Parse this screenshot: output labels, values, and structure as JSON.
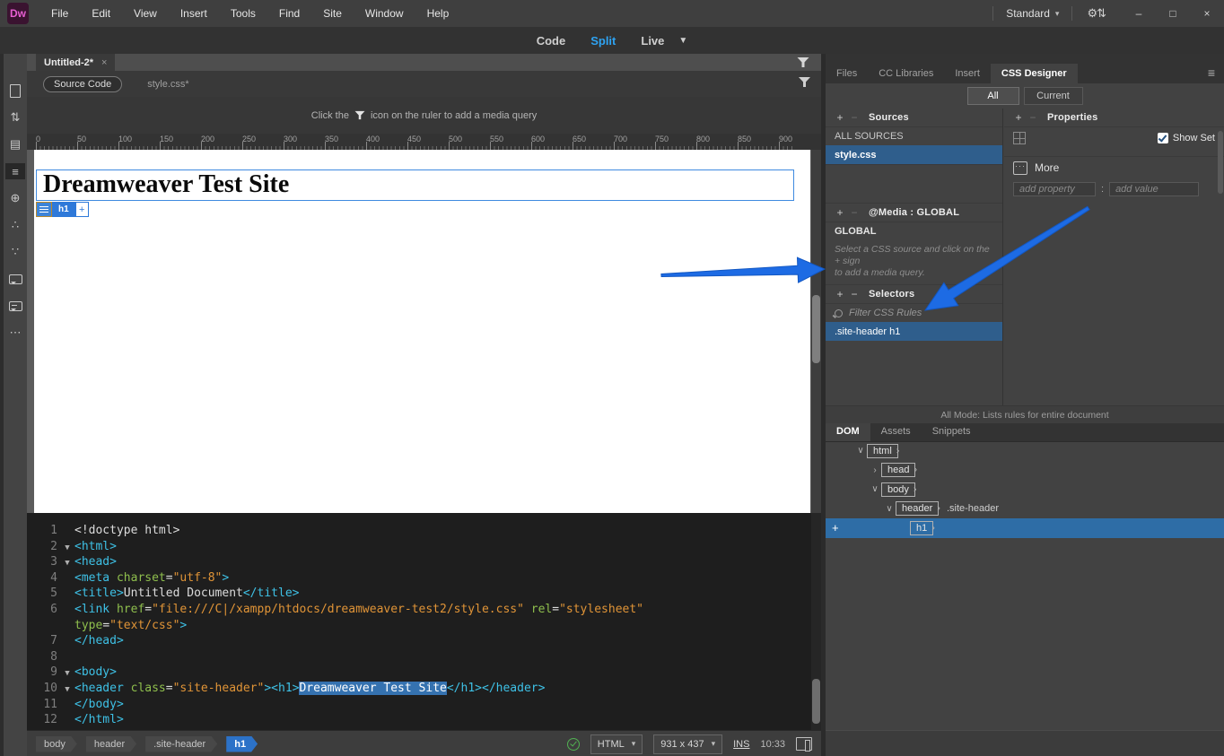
{
  "menubar": {
    "logo": "Dw",
    "items": [
      "File",
      "Edit",
      "View",
      "Insert",
      "Tools",
      "Find",
      "Site",
      "Window",
      "Help"
    ],
    "workspace": "Standard",
    "window_minimize": "–",
    "window_maximize": "□",
    "window_close": "×"
  },
  "viewbar": {
    "modes": [
      {
        "label": "Code",
        "active": false
      },
      {
        "label": "Split",
        "active": true
      },
      {
        "label": "Live",
        "active": false
      }
    ]
  },
  "left_toolbar": {
    "icons": [
      {
        "name": "new-file-icon",
        "glyph": "",
        "cls": "gi-file",
        "active": false
      },
      {
        "name": "file-transfer-icon",
        "glyph": "⇅",
        "cls": "",
        "active": false
      },
      {
        "name": "live-source-icon",
        "glyph": "▤",
        "cls": "",
        "active": false
      },
      {
        "name": "format-source-icon",
        "glyph": "≡",
        "cls": "",
        "active": true
      },
      {
        "name": "inspect-icon",
        "glyph": "⊕",
        "cls": "",
        "active": false
      },
      {
        "name": "extract-icon",
        "glyph": "∴",
        "cls": "",
        "active": false
      },
      {
        "name": "snippets-icon",
        "glyph": "∵",
        "cls": "",
        "active": false
      },
      {
        "name": "comment-icon",
        "glyph": "",
        "cls": "gi-bubble",
        "active": false
      },
      {
        "name": "comment-off-icon",
        "glyph": "",
        "cls": "gi-bubble2",
        "active": false
      },
      {
        "name": "more-options-icon",
        "glyph": "⋯",
        "cls": "",
        "active": false
      }
    ]
  },
  "doc": {
    "tab": "Untitled-2*",
    "tab_close": "×",
    "source_code": "Source Code",
    "related_file": "style.css*",
    "hint_before": "Click the",
    "hint_after": "icon on the ruler to add a media query",
    "ruler_labels": [
      "0",
      "50",
      "100",
      "150",
      "200",
      "250",
      "300",
      "350",
      "400",
      "450",
      "500",
      "550",
      "600",
      "650",
      "700",
      "750",
      "800",
      "850",
      "900"
    ],
    "design_heading": "Dreamweaver Test Site",
    "element_badge": "h1",
    "add_badge": "+"
  },
  "code": {
    "lines": [
      {
        "n": "1",
        "f": "",
        "seg": [
          [
            "p",
            "<!doctype html>"
          ]
        ]
      },
      {
        "n": "2",
        "f": "v",
        "seg": [
          [
            "t",
            "<html>"
          ]
        ]
      },
      {
        "n": "3",
        "f": "v",
        "seg": [
          [
            "t",
            "<head>"
          ]
        ]
      },
      {
        "n": "4",
        "f": "",
        "seg": [
          [
            "t",
            "<meta"
          ],
          [
            "a",
            " charset"
          ],
          [
            "p",
            "="
          ],
          [
            "v",
            "\"utf-8\""
          ],
          [
            "t",
            ">"
          ]
        ]
      },
      {
        "n": "5",
        "f": "",
        "seg": [
          [
            "t",
            "<title>"
          ],
          [
            "p",
            "Untitled Document"
          ],
          [
            "t",
            "</title>"
          ]
        ]
      },
      {
        "n": "6",
        "f": "",
        "seg": [
          [
            "t",
            "<link"
          ],
          [
            "a",
            " href"
          ],
          [
            "p",
            "="
          ],
          [
            "v",
            "\"file:///C|/xampp/htdocs/dreamweaver-test2/style.css\""
          ],
          [
            "a",
            " rel"
          ],
          [
            "p",
            "="
          ],
          [
            "v",
            "\"stylesheet\""
          ]
        ]
      },
      {
        "n": "",
        "f": "",
        "seg": [
          [
            "a",
            "type"
          ],
          [
            "p",
            "="
          ],
          [
            "v",
            "\"text/css\""
          ],
          [
            "t",
            ">"
          ]
        ]
      },
      {
        "n": "7",
        "f": "",
        "seg": [
          [
            "t",
            "</head>"
          ]
        ]
      },
      {
        "n": "8",
        "f": "",
        "seg": []
      },
      {
        "n": "9",
        "f": "v",
        "seg": [
          [
            "t",
            "<body>"
          ]
        ]
      },
      {
        "n": "10",
        "f": "v",
        "seg": [
          [
            "t",
            "<header"
          ],
          [
            "a",
            " class"
          ],
          [
            "p",
            "="
          ],
          [
            "v",
            "\"site-header\""
          ],
          [
            "t",
            "><h1>"
          ],
          [
            "s",
            "Dreamweaver Test Site"
          ],
          [
            "t",
            "</h1></header>"
          ]
        ]
      },
      {
        "n": "11",
        "f": "",
        "seg": [
          [
            "t",
            "</body>"
          ]
        ]
      },
      {
        "n": "12",
        "f": "",
        "seg": [
          [
            "t",
            "</html>"
          ]
        ]
      }
    ]
  },
  "statusbar": {
    "path": [
      "body",
      "header",
      ".site-header",
      "h1"
    ],
    "doctype": "HTML",
    "dimensions": "931 x 437",
    "mode": "INS",
    "time": "10:33"
  },
  "panel": {
    "tabs": [
      "Files",
      "CC Libraries",
      "Insert",
      "CSS Designer"
    ],
    "active_tab": "CSS Designer",
    "modes": [
      {
        "label": "All",
        "active": true
      },
      {
        "label": "Current",
        "active": false
      }
    ],
    "sources": {
      "title": "Sources",
      "item_all": "ALL SOURCES",
      "item_file": "style.css"
    },
    "media": {
      "title": "@Media :  GLOBAL",
      "item": "GLOBAL",
      "hint_line1": "Select a CSS source and click on the + sign",
      "hint_line2": "to add a media query."
    },
    "selectors": {
      "title": "Selectors",
      "filter_placeholder": "Filter CSS Rules",
      "selected": ".site-header h1"
    },
    "properties": {
      "title": "Properties",
      "show_set": "Show Set",
      "more": "More",
      "add_property": "add property",
      "add_value": "add value"
    },
    "footer": "All Mode: Lists rules for entire document"
  },
  "dom": {
    "tabs": [
      "DOM",
      "Assets",
      "Snippets"
    ],
    "active_tab": "DOM",
    "tree": [
      {
        "exp": "v",
        "tag": "html",
        "suffix": "",
        "lvl": 0,
        "sel": false
      },
      {
        "exp": ">",
        "tag": "head",
        "suffix": "",
        "lvl": 1,
        "sel": false
      },
      {
        "exp": "v",
        "tag": "body",
        "suffix": "",
        "lvl": 1,
        "sel": false
      },
      {
        "exp": "v",
        "tag": "header",
        "suffix": ".site-header",
        "lvl": 2,
        "sel": false
      },
      {
        "exp": "",
        "tag": "h1",
        "suffix": "",
        "lvl": 3,
        "sel": true
      }
    ]
  },
  "colors": {
    "accent_blue": "#2ea3f2",
    "selection_blue": "#2f5e8c",
    "arrow_blue": "#1d6be4",
    "code_tag": "#3ec1e6",
    "code_attr": "#8fbf4d",
    "code_value": "#e09437"
  }
}
